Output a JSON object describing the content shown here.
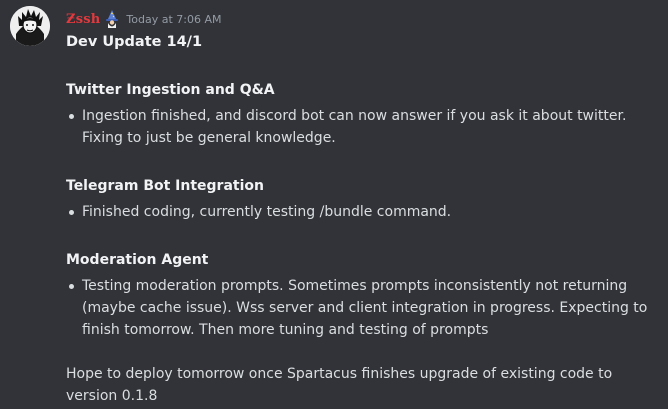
{
  "message": {
    "author": "Ƶssh",
    "timestamp": "Today at 7:06 AM",
    "title": "Dev Update 14/1",
    "sections": [
      {
        "heading": "Twitter Ingestion and Q&A",
        "bullets": [
          "Ingestion finished, and discord bot can now answer if you ask it about twitter. Fixing to just be general knowledge."
        ]
      },
      {
        "heading": "Telegram Bot Integration",
        "bullets": [
          "Finished coding, currently testing /bundle command."
        ]
      },
      {
        "heading": "Moderation Agent",
        "bullets": [
          "Testing moderation prompts. Sometimes prompts inconsistently not returning (maybe cache issue). Wss server and client integration in progress. Expecting to finish tomorrow. Then more tuning and testing of prompts"
        ]
      }
    ],
    "footer": "Hope to deploy tomorrow once Spartacus finishes upgrade of existing code to version 0.1.8"
  },
  "colors": {
    "background": "#313338",
    "username": "#e0393e",
    "text": "#dbdee1",
    "timestamp": "#949ba4"
  },
  "icons": {
    "avatar": "avatar-portrait",
    "role": "wizard-icon"
  }
}
